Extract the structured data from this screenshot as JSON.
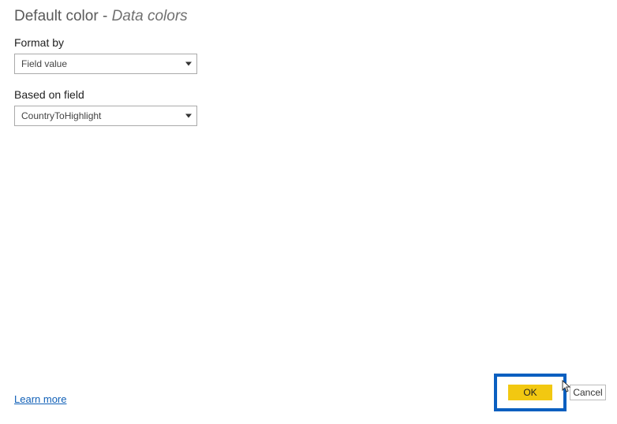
{
  "header": {
    "title_main": "Default color",
    "title_separator": " - ",
    "title_sub": "Data colors"
  },
  "form": {
    "format_by": {
      "label": "Format by",
      "value": "Field value"
    },
    "based_on_field": {
      "label": "Based on field",
      "value": "CountryToHighlight"
    }
  },
  "footer": {
    "learn_more": "Learn more"
  },
  "buttons": {
    "ok": "OK",
    "cancel": "Cancel"
  }
}
